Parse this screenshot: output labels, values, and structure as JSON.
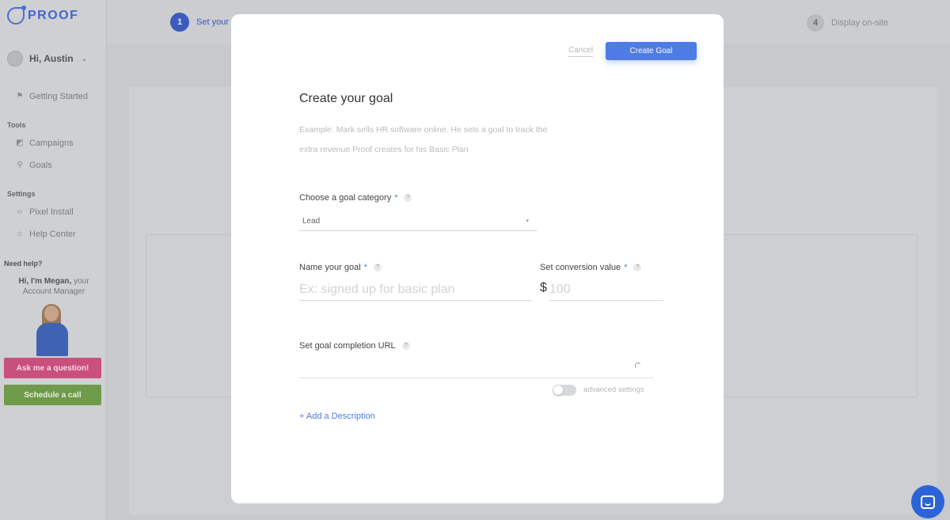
{
  "sidebar": {
    "logo_text": "PROOF",
    "user_greeting": "Hi, Austin",
    "nav": {
      "getting_started": "Getting Started",
      "tools_label": "Tools",
      "campaigns": "Campaigns",
      "goals": "Goals",
      "settings_label": "Settings",
      "pixel_install": "Pixel Install",
      "help_center": "Help Center"
    },
    "help": {
      "label": "Need help?",
      "manager_intro": "Hi, I'm Megan,",
      "manager_role": " your Account Manager",
      "ask_button": "Ask me a question!",
      "schedule_button": "Schedule a call"
    }
  },
  "steps": {
    "step1_num": "1",
    "step1_label": "Set your",
    "step4_num": "4",
    "step4_label": "Display on-site"
  },
  "modal": {
    "cancel_label": "Cancel",
    "create_label": "Create Goal",
    "title": "Create your goal",
    "example_text": "Example: Mark sells HR software online. He sets a goal to track the extra revenue Proof creates for his Basic Plan",
    "category": {
      "label": "Choose a goal category",
      "required": "*",
      "help": "?",
      "selected": "Lead",
      "caret": "▾"
    },
    "goal_name": {
      "label": "Name your goal",
      "required": "*",
      "help": "?",
      "placeholder": "Ex: signed up for basic plan"
    },
    "conversion": {
      "label": "Set conversion value",
      "required": "*",
      "help": "?",
      "currency": "$",
      "placeholder": "100"
    },
    "url": {
      "label": "Set goal completion URL",
      "help": "?"
    },
    "advanced_label": "advanced settings",
    "add_description": "+ Add a Description"
  },
  "colors": {
    "accent": "#4e7ce6",
    "ask_button": "#c94f7d",
    "schedule_button": "#6f9a4a",
    "chat_launcher": "#2c64d8"
  },
  "icons": [
    "logo-icon",
    "chevron-down-icon",
    "rocket-icon",
    "campaign-icon",
    "goal-icon",
    "code-icon",
    "home-icon",
    "help-icon",
    "spinner-icon",
    "chat-icon"
  ]
}
